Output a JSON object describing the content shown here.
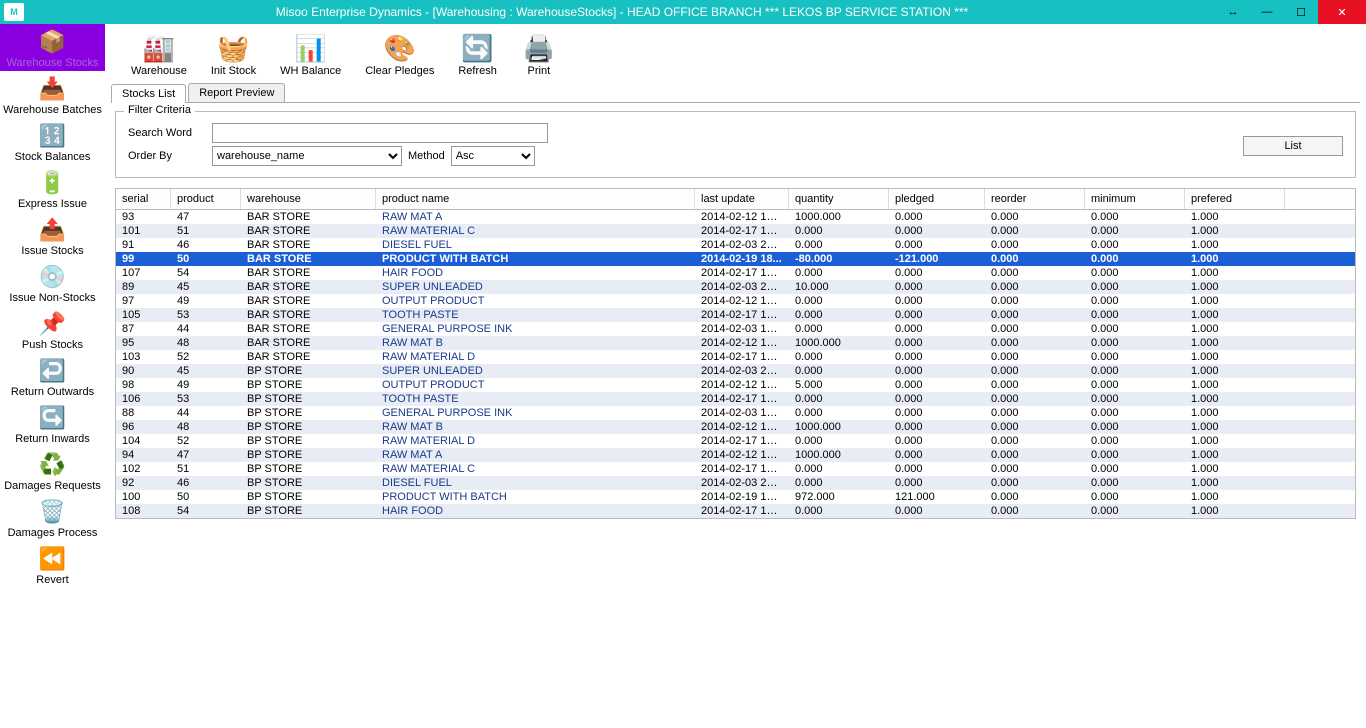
{
  "title": "Misoo Enterprise Dynamics - [Warehousing : WarehouseStocks] - HEAD OFFICE BRANCH *** LEKOS BP SERVICE STATION ***",
  "sidebar": [
    {
      "label": "Warehouse Stocks",
      "icon": "📦",
      "sel": true
    },
    {
      "label": "Warehouse Batches",
      "icon": "📥"
    },
    {
      "label": "Stock Balances",
      "icon": "🔢"
    },
    {
      "label": "Express Issue",
      "icon": "🔋"
    },
    {
      "label": "Issue Stocks",
      "icon": "📤"
    },
    {
      "label": "Issue Non-Stocks",
      "icon": "💿"
    },
    {
      "label": "Push Stocks",
      "icon": "📌"
    },
    {
      "label": "Return Outwards",
      "icon": "↩️"
    },
    {
      "label": "Return Inwards",
      "icon": "↪️"
    },
    {
      "label": "Damages Requests",
      "icon": "♻️"
    },
    {
      "label": "Damages Process",
      "icon": "🗑️"
    },
    {
      "label": "Revert",
      "icon": "⏪"
    }
  ],
  "toolbar": [
    {
      "label": "Warehouse",
      "icon": "🏭"
    },
    {
      "label": "Init Stock",
      "icon": "🧺"
    },
    {
      "label": "WH Balance",
      "icon": "📊"
    },
    {
      "label": "Clear Pledges",
      "icon": "🎨"
    },
    {
      "label": "Refresh",
      "icon": "🔄"
    },
    {
      "label": "Print",
      "icon": "🖨️"
    }
  ],
  "tabs": {
    "stocks": "Stocks List",
    "report": "Report Preview"
  },
  "filter": {
    "legend": "Filter Criteria",
    "search_label": "Search Word",
    "order_label": "Order By",
    "order_value": "warehouse_name",
    "method_label": "Method",
    "method_value": "Asc",
    "list_btn": "List"
  },
  "columns": [
    "serial",
    "product",
    "warehouse",
    "product name",
    "last update",
    "quantity",
    "pledged",
    "reorder",
    "minimum",
    "prefered"
  ],
  "rows": [
    {
      "serial": "93",
      "product": "47",
      "wh": "BAR STORE",
      "pname": "RAW MAT A",
      "upd": "2014-02-12 13:...",
      "qty": "1000.000",
      "pl": "0.000",
      "re": "0.000",
      "min": "0.000",
      "pref": "1.000"
    },
    {
      "serial": "101",
      "product": "51",
      "wh": "BAR STORE",
      "pname": "RAW MATERIAL C",
      "upd": "2014-02-17 14:...",
      "qty": "0.000",
      "pl": "0.000",
      "re": "0.000",
      "min": "0.000",
      "pref": "1.000"
    },
    {
      "serial": "91",
      "product": "46",
      "wh": "BAR STORE",
      "pname": "DIESEL FUEL",
      "upd": "2014-02-03 20:...",
      "qty": "0.000",
      "pl": "0.000",
      "re": "0.000",
      "min": "0.000",
      "pref": "1.000"
    },
    {
      "serial": "99",
      "product": "50",
      "wh": "BAR STORE",
      "pname": "PRODUCT WITH BATCH",
      "upd": "2014-02-19 18...",
      "qty": "-80.000",
      "pl": "-121.000",
      "re": "0.000",
      "min": "0.000",
      "pref": "1.000",
      "sel": true
    },
    {
      "serial": "107",
      "product": "54",
      "wh": "BAR STORE",
      "pname": "HAIR FOOD",
      "upd": "2014-02-17 14:...",
      "qty": "0.000",
      "pl": "0.000",
      "re": "0.000",
      "min": "0.000",
      "pref": "1.000"
    },
    {
      "serial": "89",
      "product": "45",
      "wh": "BAR STORE",
      "pname": "SUPER UNLEADED",
      "upd": "2014-02-03 20:...",
      "qty": "10.000",
      "pl": "0.000",
      "re": "0.000",
      "min": "0.000",
      "pref": "1.000"
    },
    {
      "serial": "97",
      "product": "49",
      "wh": "BAR STORE",
      "pname": "OUTPUT PRODUCT",
      "upd": "2014-02-12 13:...",
      "qty": "0.000",
      "pl": "0.000",
      "re": "0.000",
      "min": "0.000",
      "pref": "1.000"
    },
    {
      "serial": "105",
      "product": "53",
      "wh": "BAR STORE",
      "pname": "TOOTH PASTE",
      "upd": "2014-02-17 14:...",
      "qty": "0.000",
      "pl": "0.000",
      "re": "0.000",
      "min": "0.000",
      "pref": "1.000"
    },
    {
      "serial": "87",
      "product": "44",
      "wh": "BAR STORE",
      "pname": "GENERAL PURPOSE INK",
      "upd": "2014-02-03 14:...",
      "qty": "0.000",
      "pl": "0.000",
      "re": "0.000",
      "min": "0.000",
      "pref": "1.000"
    },
    {
      "serial": "95",
      "product": "48",
      "wh": "BAR STORE",
      "pname": "RAW MAT B",
      "upd": "2014-02-12 13:...",
      "qty": "1000.000",
      "pl": "0.000",
      "re": "0.000",
      "min": "0.000",
      "pref": "1.000"
    },
    {
      "serial": "103",
      "product": "52",
      "wh": "BAR STORE",
      "pname": "RAW MATERIAL D",
      "upd": "2014-02-17 14:...",
      "qty": "0.000",
      "pl": "0.000",
      "re": "0.000",
      "min": "0.000",
      "pref": "1.000"
    },
    {
      "serial": "90",
      "product": "45",
      "wh": "BP STORE",
      "pname": "SUPER UNLEADED",
      "upd": "2014-02-03 20:...",
      "qty": "0.000",
      "pl": "0.000",
      "re": "0.000",
      "min": "0.000",
      "pref": "1.000"
    },
    {
      "serial": "98",
      "product": "49",
      "wh": "BP STORE",
      "pname": "OUTPUT PRODUCT",
      "upd": "2014-02-12 13:...",
      "qty": "5.000",
      "pl": "0.000",
      "re": "0.000",
      "min": "0.000",
      "pref": "1.000"
    },
    {
      "serial": "106",
      "product": "53",
      "wh": "BP STORE",
      "pname": "TOOTH PASTE",
      "upd": "2014-02-17 14:...",
      "qty": "0.000",
      "pl": "0.000",
      "re": "0.000",
      "min": "0.000",
      "pref": "1.000"
    },
    {
      "serial": "88",
      "product": "44",
      "wh": "BP STORE",
      "pname": "GENERAL PURPOSE INK",
      "upd": "2014-02-03 14:...",
      "qty": "0.000",
      "pl": "0.000",
      "re": "0.000",
      "min": "0.000",
      "pref": "1.000"
    },
    {
      "serial": "96",
      "product": "48",
      "wh": "BP STORE",
      "pname": "RAW MAT B",
      "upd": "2014-02-12 13:...",
      "qty": "1000.000",
      "pl": "0.000",
      "re": "0.000",
      "min": "0.000",
      "pref": "1.000"
    },
    {
      "serial": "104",
      "product": "52",
      "wh": "BP STORE",
      "pname": "RAW MATERIAL D",
      "upd": "2014-02-17 14:...",
      "qty": "0.000",
      "pl": "0.000",
      "re": "0.000",
      "min": "0.000",
      "pref": "1.000"
    },
    {
      "serial": "94",
      "product": "47",
      "wh": "BP STORE",
      "pname": "RAW MAT A",
      "upd": "2014-02-12 13:...",
      "qty": "1000.000",
      "pl": "0.000",
      "re": "0.000",
      "min": "0.000",
      "pref": "1.000"
    },
    {
      "serial": "102",
      "product": "51",
      "wh": "BP STORE",
      "pname": "RAW MATERIAL C",
      "upd": "2014-02-17 14:...",
      "qty": "0.000",
      "pl": "0.000",
      "re": "0.000",
      "min": "0.000",
      "pref": "1.000"
    },
    {
      "serial": "92",
      "product": "46",
      "wh": "BP STORE",
      "pname": "DIESEL FUEL",
      "upd": "2014-02-03 20:...",
      "qty": "0.000",
      "pl": "0.000",
      "re": "0.000",
      "min": "0.000",
      "pref": "1.000"
    },
    {
      "serial": "100",
      "product": "50",
      "wh": "BP STORE",
      "pname": "PRODUCT WITH BATCH",
      "upd": "2014-02-19 17:...",
      "qty": "972.000",
      "pl": "121.000",
      "re": "0.000",
      "min": "0.000",
      "pref": "1.000"
    },
    {
      "serial": "108",
      "product": "54",
      "wh": "BP STORE",
      "pname": "HAIR FOOD",
      "upd": "2014-02-17 14:...",
      "qty": "0.000",
      "pl": "0.000",
      "re": "0.000",
      "min": "0.000",
      "pref": "1.000"
    }
  ]
}
